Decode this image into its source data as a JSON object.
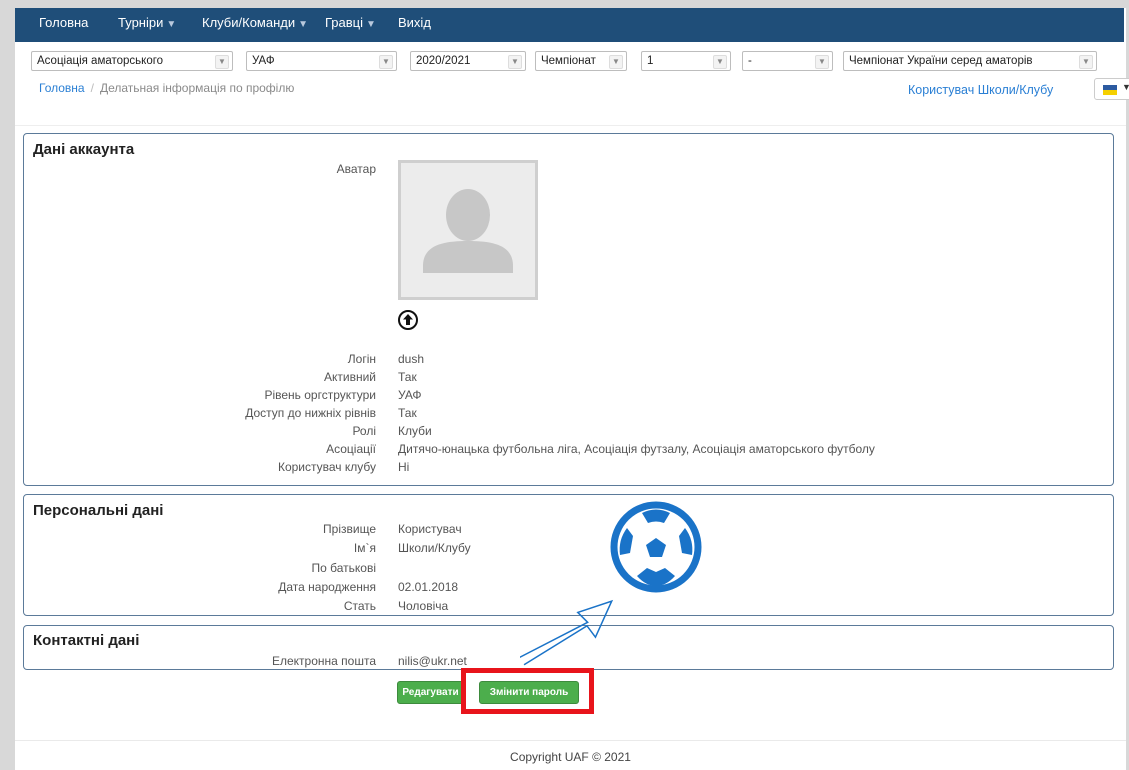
{
  "nav": {
    "items": [
      "Головна",
      "Турніри",
      "Клуби/Команди",
      "Гравці",
      "Вихід"
    ]
  },
  "filters": [
    "Асоціація аматорського",
    "УАФ",
    "2020/2021",
    "Чемпіонат",
    "1",
    "-",
    "Чемпіонат України серед аматорів"
  ],
  "breadcrumb": {
    "home": "Головна",
    "separator": "/",
    "current": "Делатьная інформація по профілю"
  },
  "user": {
    "link": "Користувач Школи/Клубу"
  },
  "account": {
    "title": "Дані аккаунта",
    "avatar_label": "Аватар",
    "fields": [
      {
        "label": "Логін",
        "value": "dush"
      },
      {
        "label": "Активний",
        "value": "Так"
      },
      {
        "label": "Рівень оргструктури",
        "value": "УАФ"
      },
      {
        "label": "Доступ до нижніх рівнів",
        "value": "Так"
      },
      {
        "label": "Ролі",
        "value": "Клуби"
      },
      {
        "label": "Асоціації",
        "value": "Дитячо-юнацька футбольна ліга, Асоціація футзалу, Асоціація аматорського футболу"
      },
      {
        "label": "Користувач клубу",
        "value": "Ні"
      }
    ]
  },
  "personal": {
    "title": "Персональні дані",
    "fields": [
      {
        "label": "Прізвище",
        "value": "Користувач"
      },
      {
        "label": "Ім`я",
        "value": "Школи/Клубу"
      },
      {
        "label": "По батькові",
        "value": ""
      },
      {
        "label": "Дата народження",
        "value": "02.01.2018"
      },
      {
        "label": "Стать",
        "value": "Чоловіча"
      }
    ]
  },
  "contacts": {
    "title": "Контактні дані",
    "fields": [
      {
        "label": "Електронна пошта",
        "value": "nilis@ukr.net"
      }
    ]
  },
  "buttons": {
    "edit": "Редагувати",
    "change_password": "Змінити пароль"
  },
  "footer": {
    "copyright": "Copyright UAF ©  2021"
  },
  "colors": {
    "navbar": "#1f4e79",
    "link": "#2a7fd4",
    "button": "#4cae4c",
    "highlight": "#e8141b",
    "annotation": "#1a73c8"
  },
  "icons": {
    "caret": "▾",
    "upload": "circle-arrow-up-icon",
    "avatar": "user-silhouette-icon",
    "ball": "soccer-ball-icon"
  }
}
